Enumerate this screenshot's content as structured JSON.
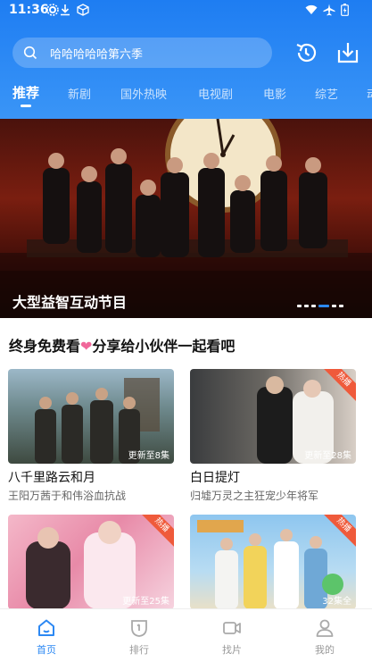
{
  "status_bar": {
    "time": "11:36"
  },
  "search": {
    "query": "哈哈哈哈哈第六季"
  },
  "tabs": [
    {
      "label": "推荐",
      "active": true
    },
    {
      "label": "新剧"
    },
    {
      "label": "国外热映"
    },
    {
      "label": "电视剧"
    },
    {
      "label": "电影"
    },
    {
      "label": "综艺"
    },
    {
      "label": "动"
    }
  ],
  "banner": {
    "title": "大型益智互动节目"
  },
  "section": {
    "title_before": "终身免费看",
    "title_after": "分享给小伙伴一起看吧"
  },
  "cards": [
    {
      "title": "八千里路云和月",
      "subtitle": "王阳万茜于和伟浴血抗战",
      "episodes": "更新至8集",
      "badge": ""
    },
    {
      "title": "白日提灯",
      "subtitle": "归墟万灵之主狂宠少年将军",
      "episodes": "更新至28集",
      "badge": "热播"
    },
    {
      "title": "",
      "subtitle": "",
      "episodes": "更新至25集",
      "badge": "热播"
    },
    {
      "title": "",
      "subtitle": "",
      "episodes": "32集全",
      "badge": "热播"
    }
  ],
  "bottom_nav": [
    {
      "label": "首页",
      "icon": "home-icon",
      "active": true
    },
    {
      "label": "排行",
      "icon": "ranking-icon"
    },
    {
      "label": "找片",
      "icon": "video-camera-icon"
    },
    {
      "label": "我的",
      "icon": "user-icon"
    }
  ],
  "colors": {
    "primary": "#1e7df2",
    "active_nav": "#2c88f3",
    "badge": "#ef5a3b",
    "heart": "#f0679a"
  }
}
